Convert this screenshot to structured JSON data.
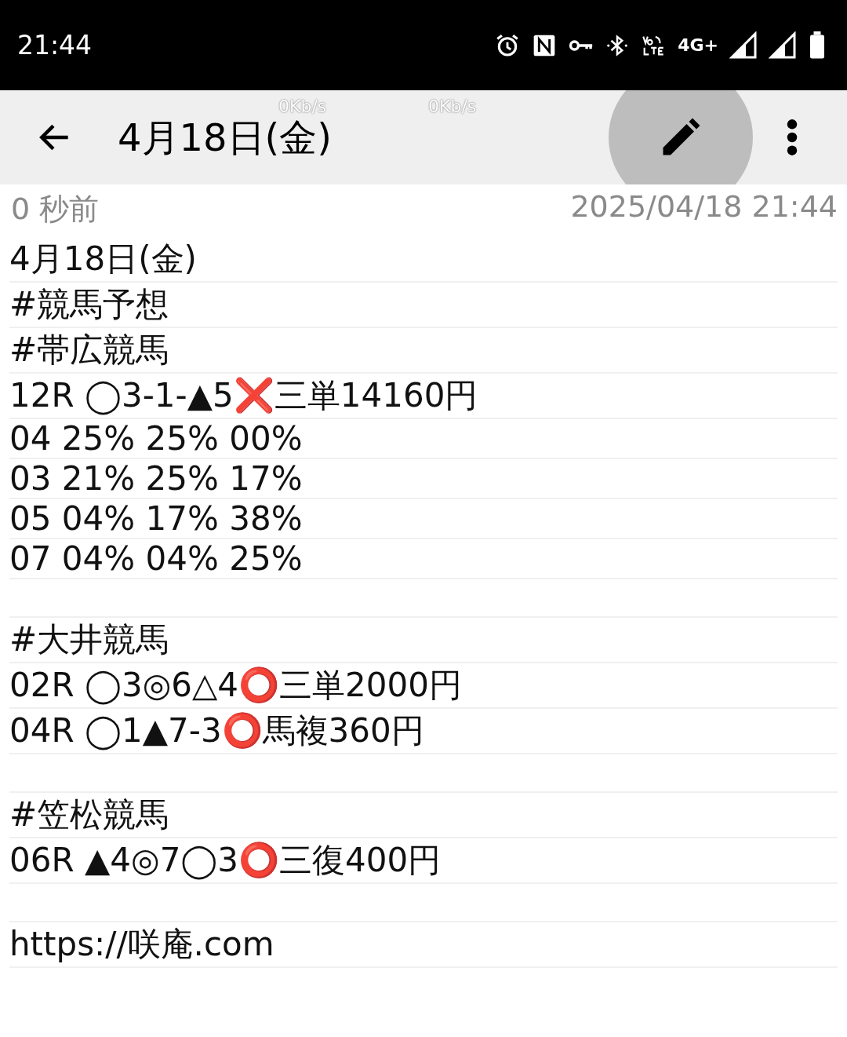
{
  "status_bar": {
    "time": "21:44",
    "network_label": "4G+"
  },
  "net_speeds": [
    "0Kb/s",
    "0Kb/s"
  ],
  "toolbar": {
    "title": "4月18日(金)"
  },
  "meta": {
    "relative_time": "0 秒前",
    "timestamp": "2025/04/18 21:44"
  },
  "sections": [
    {
      "lines": [
        "4月18日(金)",
        "#競馬予想",
        "#帯広競馬",
        "12R ◯3-1-▲5❌三単14160円",
        "04 25% 25% 00%",
        "03 21% 25% 17%",
        "05 04% 17% 38%",
        "07 04% 04% 25%"
      ]
    },
    {
      "lines": [
        "#大井競馬",
        "02R ◯3◎6△4⭕三単2000円",
        "04R ◯1▲7-3⭕馬複360円"
      ]
    },
    {
      "lines": [
        "#笠松競馬",
        "06R ▲4◎7◯3⭕三復400円"
      ]
    },
    {
      "lines": [
        "https://咲庵.com"
      ]
    }
  ]
}
